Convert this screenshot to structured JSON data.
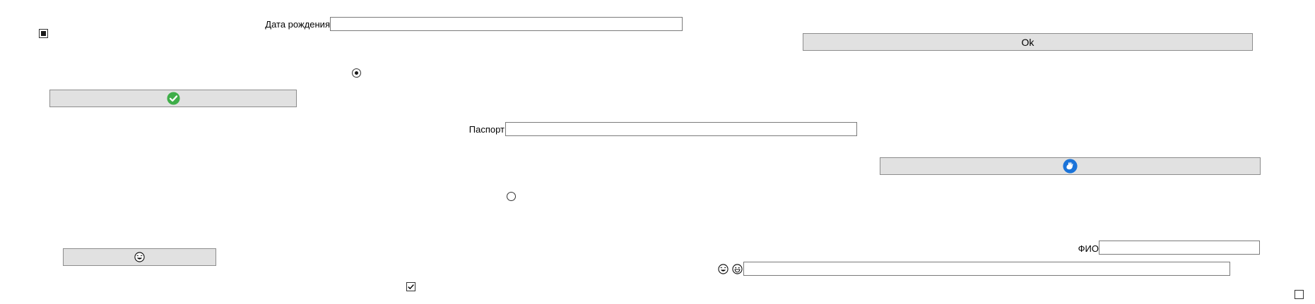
{
  "form": {
    "birth_date": {
      "label": "Дата рождения",
      "value": ""
    },
    "passport": {
      "label": "Паспорт",
      "value": ""
    },
    "full_name": {
      "label": "ФИО",
      "value": ""
    },
    "emoji_field": {
      "value": ""
    }
  },
  "buttons": {
    "ok_label": "Ok",
    "check_icon": "green-checkmark-icon",
    "blue_icon": "blue-hand-icon",
    "emoji_icon": "laughing-face-icon"
  },
  "controls": {
    "checkbox_top": {
      "state": "indeterminate"
    },
    "checkbox_bottom": {
      "state": "checked"
    },
    "checkbox_corner": {
      "state": "unchecked"
    },
    "radio_top": {
      "state": "checked"
    },
    "radio_middle": {
      "state": "unchecked"
    }
  },
  "emoji_row": {
    "icons": [
      "laughing-face-icon",
      "grinning-face-icon"
    ]
  },
  "colors": {
    "button_bg": "#e1e1e1",
    "check_green": "#3fae49",
    "icon_blue": "#1a73d9"
  }
}
